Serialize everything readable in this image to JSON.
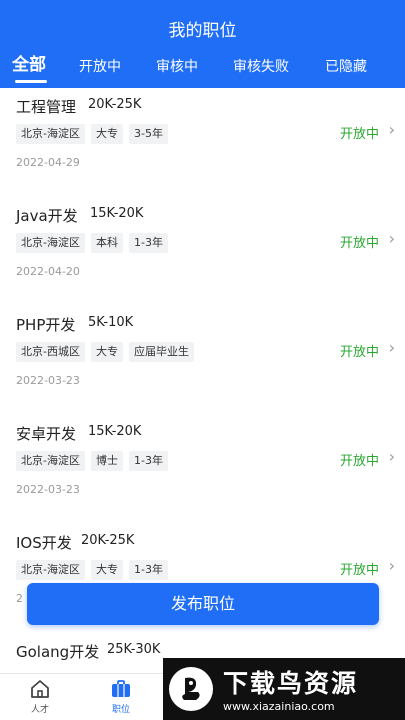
{
  "header": {
    "title": "我的职位"
  },
  "tabs": [
    "全部",
    "开放中",
    "审核中",
    "审核失败",
    "已隐藏"
  ],
  "jobs": [
    {
      "title": "工程管理",
      "salary": "20K-25K",
      "tags": [
        "北京-海淀区",
        "大专",
        "3-5年"
      ],
      "status": "开放中",
      "date": "2022-04-29"
    },
    {
      "title": "Java开发",
      "salary": "15K-20K",
      "tags": [
        "北京-海淀区",
        "本科",
        "1-3年"
      ],
      "status": "开放中",
      "date": "2022-04-20"
    },
    {
      "title": "PHP开发",
      "salary": "5K-10K",
      "tags": [
        "北京-西城区",
        "大专",
        "应届毕业生"
      ],
      "status": "开放中",
      "date": "2022-03-23"
    },
    {
      "title": "安卓开发",
      "salary": "15K-20K",
      "tags": [
        "北京-海淀区",
        "博士",
        "1-3年"
      ],
      "status": "开放中",
      "date": "2022-03-23"
    },
    {
      "title": "IOS开发",
      "salary": "20K-25K",
      "tags": [
        "北京-海淀区",
        "大专",
        "1-3年"
      ],
      "status": "开放中",
      "date": "2"
    },
    {
      "title": "Golang开发",
      "salary": "25K-30K"
    }
  ],
  "publish_button": "发布职位",
  "bottom_nav": [
    {
      "label": "人才",
      "icon": "home-icon"
    },
    {
      "label": "职位",
      "icon": "briefcase-icon"
    }
  ],
  "watermark": {
    "big": "下载鸟资源",
    "small": "www.xiazainiao.com"
  },
  "colors": {
    "primary": "#1f6ef5",
    "status_open": "#2aa831"
  }
}
